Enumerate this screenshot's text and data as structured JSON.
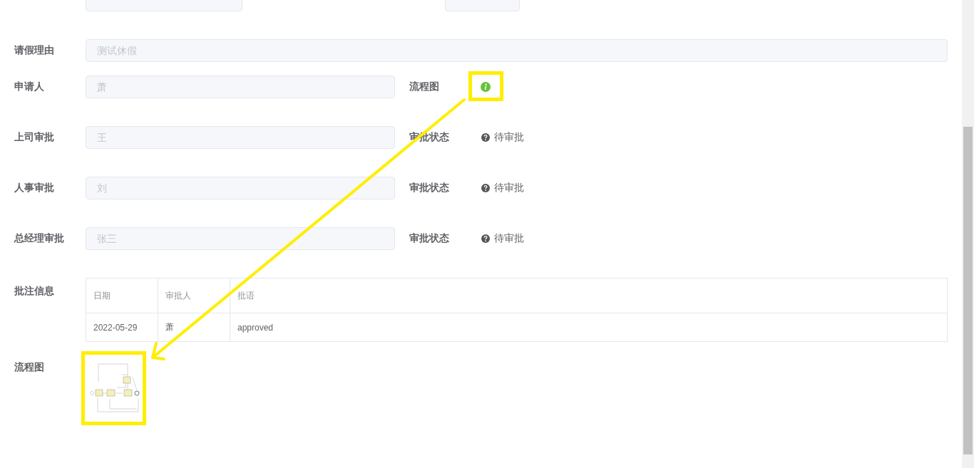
{
  "form": {
    "rows": [
      {
        "kind": "dates",
        "items": [
          {
            "kind": "date"
          },
          {
            "kind": "date"
          }
        ]
      },
      {
        "kind": "full",
        "items": [
          {
            "kind": "input",
            "label": "请假理由",
            "value": "测试休假",
            "disabled": true
          }
        ]
      },
      {
        "kind": "pair",
        "items": [
          {
            "kind": "input",
            "label": "申请人",
            "value": "萧",
            "disabled": true
          },
          {
            "kind": "info",
            "label": "流程图"
          }
        ]
      },
      {
        "kind": "pair",
        "items": [
          {
            "kind": "input",
            "label": "上司审批",
            "value": "王",
            "disabled": true
          },
          {
            "kind": "status",
            "label": "审批状态",
            "value": "待审批"
          }
        ]
      },
      {
        "kind": "pair",
        "items": [
          {
            "kind": "input",
            "label": "人事审批",
            "value": "刘",
            "disabled": true
          },
          {
            "kind": "status",
            "label": "审批状态",
            "value": "待审批"
          }
        ]
      },
      {
        "kind": "pair",
        "items": [
          {
            "kind": "input",
            "label": "总经理审批",
            "value": "张三",
            "disabled": true
          },
          {
            "kind": "status",
            "label": "审批状态",
            "value": "待审批"
          }
        ]
      }
    ]
  },
  "comments": {
    "label": "批注信息",
    "columns": [
      "日期",
      "审批人",
      "批语"
    ],
    "rows": [
      [
        "2022-05-29",
        "萧",
        "approved"
      ]
    ]
  },
  "flow_diagram": {
    "label": "流程图"
  }
}
